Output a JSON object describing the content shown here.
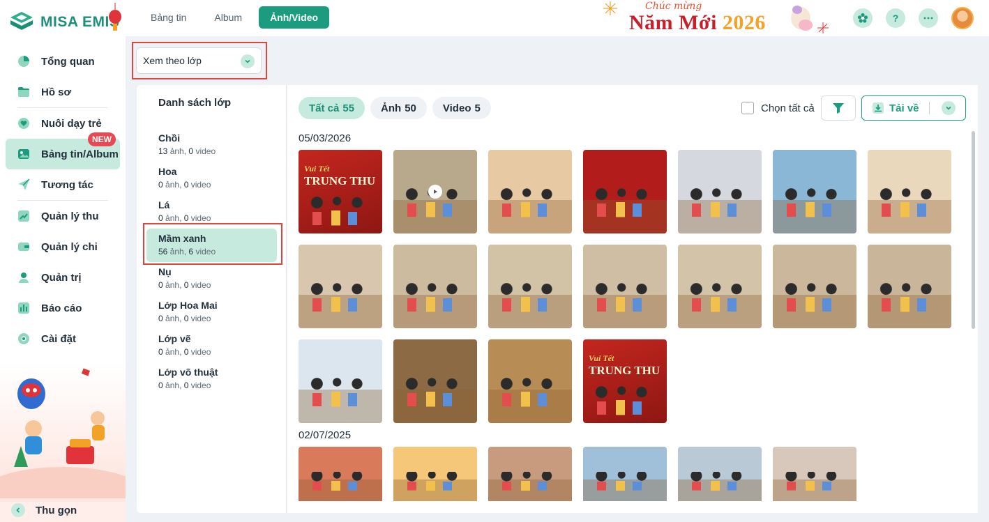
{
  "app": {
    "logo_text": "MISA EMIS"
  },
  "sidebar": {
    "items": [
      {
        "label": "Tổng quan",
        "icon": "pie-chart-icon",
        "active": false
      },
      {
        "label": "Hồ sơ",
        "icon": "folder-icon",
        "active": false
      },
      {
        "label": "Nuôi dạy trẻ",
        "icon": "heart-hand-icon",
        "active": false
      },
      {
        "label": "Bảng tin/Album",
        "icon": "image-album-icon",
        "active": true,
        "badge": "NEW"
      },
      {
        "label": "Tương tác",
        "icon": "paper-plane-icon",
        "active": false
      },
      {
        "label": "Quản lý thu",
        "icon": "trend-up-icon",
        "active": false
      },
      {
        "label": "Quản lý chi",
        "icon": "wallet-icon",
        "active": false
      },
      {
        "label": "Quản trị",
        "icon": "admin-icon",
        "active": false
      },
      {
        "label": "Báo cáo",
        "icon": "bar-chart-icon",
        "active": false
      },
      {
        "label": "Cài đặt",
        "icon": "gear-icon",
        "active": false
      }
    ],
    "collapse_label": "Thu gọn"
  },
  "topbar": {
    "tabs": [
      {
        "label": "Bảng tin",
        "active": false
      },
      {
        "label": "Album",
        "active": false
      },
      {
        "label": "Ảnh/Video",
        "active": true
      }
    ],
    "banner": {
      "script": "Chúc mừng",
      "main": "Năm Mới",
      "year": "2026"
    },
    "icons": [
      "flower-icon",
      "help-icon",
      "more-icon",
      "avatar"
    ]
  },
  "filter": {
    "view_by": "Xem theo lớp"
  },
  "class_panel": {
    "title": "Danh sách lớp",
    "classes": [
      {
        "name": "Chồi",
        "photos": "13",
        "videos": "0",
        "active": false
      },
      {
        "name": "Hoa",
        "photos": "0",
        "videos": "0",
        "active": false
      },
      {
        "name": "Lá",
        "photos": "0",
        "videos": "0",
        "active": false
      },
      {
        "name": "Mầm xanh",
        "photos": "56",
        "videos": "6",
        "active": true
      },
      {
        "name": "Nụ",
        "photos": "0",
        "videos": "0",
        "active": false
      },
      {
        "name": "Lớp Hoa Mai",
        "photos": "0",
        "videos": "0",
        "active": false
      },
      {
        "name": "Lớp vẽ",
        "photos": "0",
        "videos": "0",
        "active": false
      },
      {
        "name": "Lớp võ thuật",
        "photos": "0",
        "videos": "0",
        "active": false
      }
    ],
    "photo_unit": "ảnh",
    "video_unit": "video"
  },
  "gallery": {
    "chips": [
      {
        "label": "Tất cả",
        "count": "55",
        "active": true
      },
      {
        "label": "Ảnh",
        "count": "50",
        "active": false
      },
      {
        "label": "Video",
        "count": "5",
        "active": false
      }
    ],
    "select_all_label": "Chọn tất cả",
    "download_label": "Tải về",
    "groups": [
      {
        "date": "05/03/2026",
        "items": [
          {
            "type": "banner",
            "bg": "#c4261f",
            "text": "TRUNG THU",
            "script": "Vui Tết"
          },
          {
            "type": "video",
            "bg": "#b9a98c"
          },
          {
            "type": "photo",
            "bg": "#e7c9a3"
          },
          {
            "type": "photo",
            "bg": "#b21d1b"
          },
          {
            "type": "photo",
            "bg": "#d5d9df"
          },
          {
            "type": "photo",
            "bg": "#8bb7d6"
          },
          {
            "type": "photo",
            "bg": "#ead8bd"
          },
          {
            "type": "photo",
            "bg": "#d8c7ae"
          },
          {
            "type": "photo",
            "bg": "#cdbba0"
          },
          {
            "type": "photo",
            "bg": "#d2c2a6"
          },
          {
            "type": "photo",
            "bg": "#cfbea4"
          },
          {
            "type": "photo",
            "bg": "#d3c3a8"
          },
          {
            "type": "photo",
            "bg": "#cbb79c"
          },
          {
            "type": "photo",
            "bg": "#c9b59a"
          },
          {
            "type": "photo",
            "bg": "#dbe6ee"
          },
          {
            "type": "photo",
            "bg": "#8c6a44"
          },
          {
            "type": "photo",
            "bg": "#b88d55"
          },
          {
            "type": "banner",
            "bg": "#c4261f",
            "text": "TRUNG THU",
            "script": "Vui Tết"
          }
        ]
      },
      {
        "date": "02/07/2025",
        "items": [
          {
            "type": "photo",
            "bg": "#d97a5b"
          },
          {
            "type": "photo",
            "bg": "#f4c779"
          },
          {
            "type": "photo",
            "bg": "#c79b7d"
          },
          {
            "type": "photo",
            "bg": "#9fc0d8"
          },
          {
            "type": "photo",
            "bg": "#b9c9d5"
          },
          {
            "type": "photo",
            "bg": "#d8c8bb"
          }
        ]
      }
    ]
  }
}
